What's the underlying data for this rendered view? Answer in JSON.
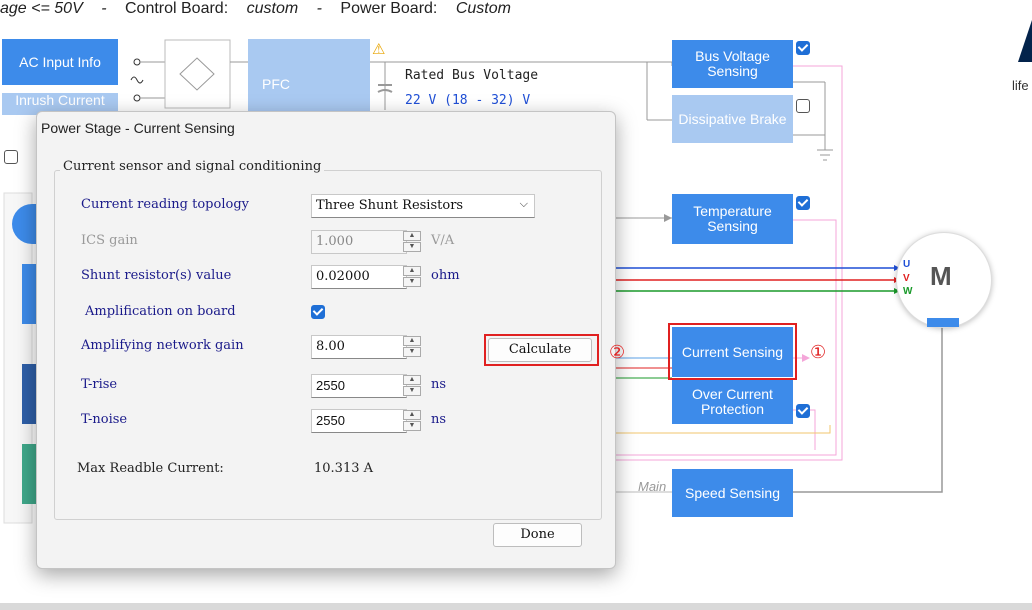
{
  "top_bar": {
    "voltage": "age <= 50V",
    "sep1": "-",
    "control_board_label": "Control Board:",
    "control_board_value": "custom",
    "sep2": "-",
    "power_board_label": "Power Board:",
    "power_board_value": "Custom"
  },
  "diagram": {
    "ac_input": "AC Input Info",
    "inrush": "Inrush Current",
    "pfc": "PFC",
    "rated_bus_label": "Rated Bus Voltage",
    "rated_bus_value": "22 V (18 - 32) V",
    "bus_voltage": "Bus Voltage Sensing",
    "dissipative": "Dissipative Brake",
    "temperature": "Temperature Sensing",
    "current_sensing": "Current Sensing",
    "over_current": "Over Current Protection",
    "speed_sensing": "Speed Sensing",
    "main_label": "Main",
    "motor": "M",
    "phase_u": "U",
    "phase_v": "V",
    "phase_w": "W",
    "marker1": "①",
    "marker2": "②",
    "logo_fragment": "life"
  },
  "dialog": {
    "title": "Power Stage - Current Sensing",
    "group_title": "Current sensor and signal conditioning",
    "topology_label": "Current reading topology",
    "topology_value": "Three Shunt Resistors",
    "ics_gain_label": "ICS gain",
    "ics_gain_value": "1.000",
    "ics_gain_unit": "V/A",
    "shunt_label": "Shunt resistor(s) value",
    "shunt_value": "0.02000",
    "shunt_unit": "ohm",
    "amp_board_label": "Amplification on board",
    "amp_gain_label": "Amplifying network gain",
    "amp_gain_value": "8.00",
    "calculate": "Calculate",
    "trise_label": "T-rise",
    "trise_value": "2550",
    "trise_unit": "ns",
    "tnoise_label": "T-noise",
    "tnoise_value": "2550",
    "tnoise_unit": "ns",
    "max_current_label": "Max Readble Current:",
    "max_current_value": "10.313 A",
    "done": "Done"
  },
  "colors": {
    "block_blue": "#3d8bea",
    "block_light": "#a9c9f1",
    "highlight": "#e02020",
    "phase_u": "#1f4fd6",
    "phase_v": "#e02020",
    "phase_w": "#1a9a2a"
  }
}
